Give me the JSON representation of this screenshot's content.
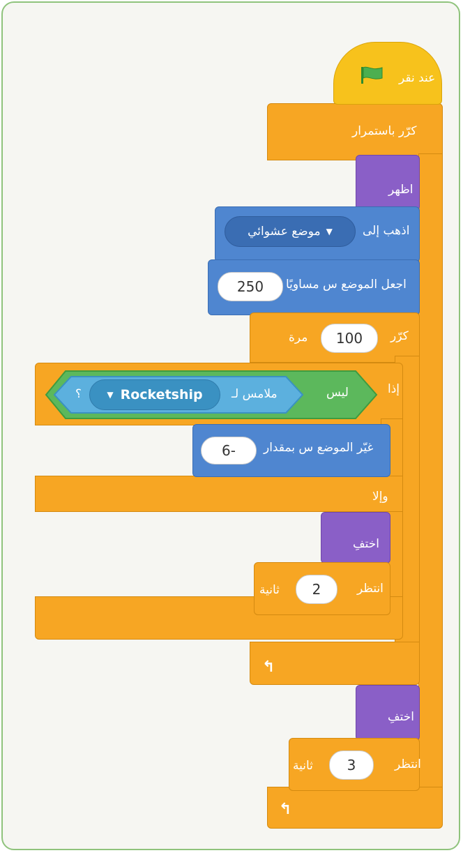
{
  "script": {
    "when_flag_clicked": "عند نقر",
    "forever": "كرّر باستمرار",
    "show_1": "اظهر",
    "go_to": {
      "label": "اذهب إلى",
      "value": "موضع عشوائي"
    },
    "set_x": {
      "label": "اجعل الموضع س مساويًا",
      "value": "250"
    },
    "repeat": {
      "label_left": "كرّر",
      "value": "100",
      "label_right": "مرة"
    },
    "if_block": {
      "if_label": "إذا",
      "not_label": "ليس",
      "touching_label": "ملامس لـ",
      "touching_value": "Rocketship",
      "question_mark": "؟",
      "else_label": "وإلا"
    },
    "change_x": {
      "label": "غيّر الموضع س بمقدار",
      "value": "6-"
    },
    "hide_1": "اختفِ",
    "wait_1": {
      "label_left": "انتظر",
      "value": "2",
      "label_right": "ثانية"
    },
    "hide_2": "اختفِ",
    "wait_2": {
      "label_left": "انتظر",
      "value": "3",
      "label_right": "ثانية"
    }
  },
  "icons": {
    "flag": "green-flag-icon",
    "loop_arrow": "loop-arrow-icon"
  },
  "colors": {
    "events": "#f7c21c",
    "control": "#f7a623",
    "looks": "#8a5fc7",
    "motion": "#4f86d0",
    "operators": "#5cb85c",
    "sensing": "#5cb0de"
  }
}
